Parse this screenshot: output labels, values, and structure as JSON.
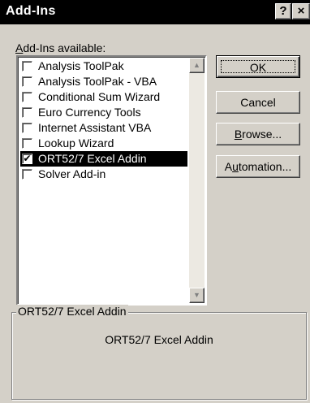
{
  "window": {
    "title": "Add-Ins",
    "help_glyph": "?",
    "close_glyph": "×"
  },
  "list": {
    "label_mnemonic": "A",
    "label_rest": "dd-Ins available:",
    "items": [
      {
        "label": "Analysis ToolPak",
        "checked": false,
        "selected": false
      },
      {
        "label": "Analysis ToolPak - VBA",
        "checked": false,
        "selected": false
      },
      {
        "label": "Conditional Sum Wizard",
        "checked": false,
        "selected": false
      },
      {
        "label": "Euro Currency Tools",
        "checked": false,
        "selected": false
      },
      {
        "label": "Internet Assistant VBA",
        "checked": false,
        "selected": false
      },
      {
        "label": "Lookup Wizard",
        "checked": false,
        "selected": false
      },
      {
        "label": "ORT52/7 Excel Addin",
        "checked": true,
        "selected": true
      },
      {
        "label": "Solver Add-in",
        "checked": false,
        "selected": false
      }
    ],
    "scroll_up_glyph": "▲",
    "scroll_down_glyph": "▼"
  },
  "buttons": {
    "ok": "OK",
    "cancel": "Cancel",
    "browse_mnemonic": "B",
    "browse_rest": "rowse...",
    "automation_pre": "A",
    "automation_mnemonic": "u",
    "automation_rest": "tomation..."
  },
  "details": {
    "group_title": "ORT52/7 Excel Addin",
    "description": "ORT52/7 Excel Addin"
  },
  "colors": {
    "face": "#d4d0c8",
    "titlebar": "#000000",
    "selection": "#000000"
  },
  "icons": {
    "checkbox_checked": "✔"
  }
}
